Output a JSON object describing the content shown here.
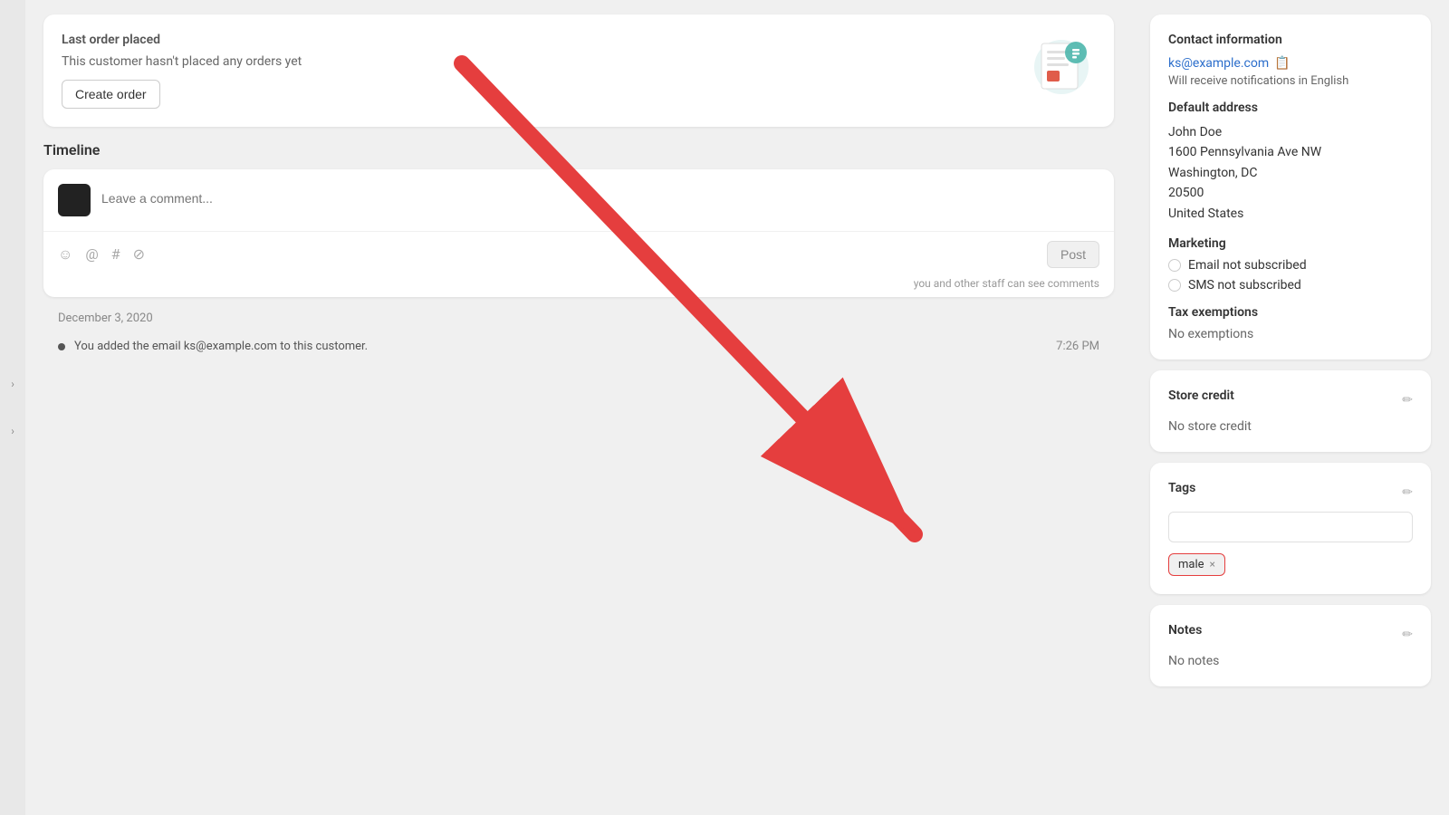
{
  "sidebar": {
    "toggle1": "›",
    "toggle2": "›"
  },
  "lastOrder": {
    "heading": "Last order placed",
    "noOrdersText": "This customer hasn't placed any orders yet",
    "createOrderLabel": "Create order"
  },
  "timeline": {
    "heading": "Timeline",
    "commentPlaceholder": "Leave a comment...",
    "postLabel": "Post",
    "staffNote": "you and other staff can see comments",
    "date": "December 3, 2020",
    "event": "You added the email ks@example.com to this customer.",
    "time": "7:26 PM"
  },
  "contactInfo": {
    "title": "Contact information",
    "email": "ks@example.com",
    "notificationLang": "Will receive notifications in English",
    "copyIconLabel": "copy-icon"
  },
  "defaultAddress": {
    "title": "Default address",
    "name": "John Doe",
    "street": "1600 Pennsylvania Ave NW",
    "city": "Washington, DC",
    "zip": "20500",
    "country": "United States"
  },
  "marketing": {
    "title": "Marketing",
    "emailLabel": "Email not subscribed",
    "smsLabel": "SMS not subscribed"
  },
  "taxExemptions": {
    "title": "Tax exemptions",
    "value": "No exemptions"
  },
  "storeCredit": {
    "title": "Store credit",
    "value": "No store credit"
  },
  "tags": {
    "title": "Tags",
    "placeholder": "",
    "tagValue": "male",
    "tagClose": "×"
  },
  "notes": {
    "title": "Notes",
    "value": "No notes"
  }
}
